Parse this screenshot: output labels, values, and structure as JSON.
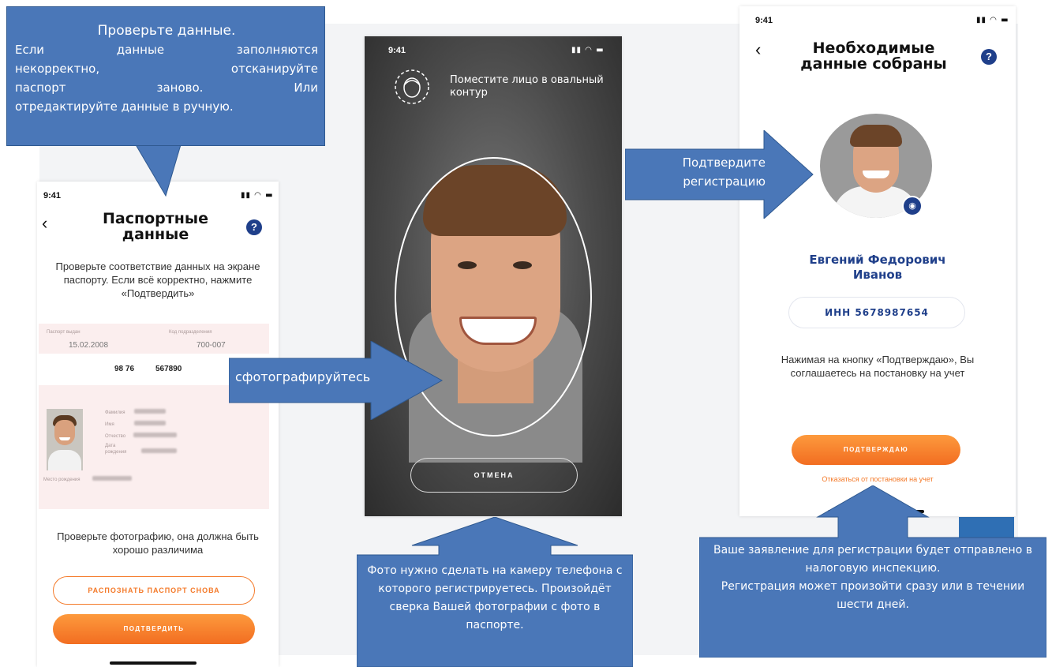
{
  "status_time": "9:41",
  "passport_screen": {
    "title_line1": "Паспортные",
    "title_line2": "данные",
    "instruction": "Проверьте соответствие данных на экране паспорту. Если всё корректно, нажмите «Подтвердить»",
    "card": {
      "issued_label": "Паспорт выдан",
      "issued_value": "15.02.2008",
      "code_label": "Код подразделения",
      "code_value": "700-007",
      "series": "98 76",
      "number": "567890",
      "surname_label": "Фамилия",
      "name_label": "Имя",
      "patronymic_label": "Отчество",
      "birth_label": "Дата рождения",
      "birthplace_label": "Место рождения"
    },
    "photo_note": "Проверьте фотографию, она должна быть хорошо различима",
    "rescan_button": "РАСПОЗНАТЬ ПАСПОРТ СНОВА",
    "confirm_button": "ПОДТВЕРДИТЬ"
  },
  "camera_screen": {
    "hint": "Поместите лицо в овальный контур",
    "cancel_button": "ОТМЕНА"
  },
  "result_screen": {
    "title_line1": "Необходимые",
    "title_line2": "данные собраны",
    "name_line1": "Евгений Федорович",
    "name_line2": "Иванов",
    "inn": "ИНН 5678987654",
    "agreement": "Нажимая на кнопку «Подтверждаю», Вы соглашаетесь на постановку на учет",
    "confirm_button": "ПОДТВЕРЖДАЮ",
    "decline_link": "Отказаться от постановки на учет"
  },
  "callouts": {
    "check_title": "Проверьте данные.",
    "check_line1": "Если данные заполняются",
    "check_line2": "некорректно, отсканируйте",
    "check_line3": "паспорт заново. Или",
    "check_line4": "отредактируйте данные в ручную.",
    "photo_arrow": "сфотографируйтесь",
    "confirm_arrow": "Подтвердите регистрацию",
    "camera_note": "Фото нужно сделать на камеру телефона с которого регистрируетесь. Произойдёт сверка Вашей фотографии с фото в паспорте.",
    "submit_note_line1": "Ваше заявление для регистрации будет отправлено в налоговую инспекцию.",
    "submit_note_line2": "Регистрация может произойти сразу или в течении шести дней."
  },
  "colors": {
    "callout_blue": "#4a77b8",
    "accent_orange": "#f47a2a",
    "title_navy": "#1f3f8a"
  }
}
